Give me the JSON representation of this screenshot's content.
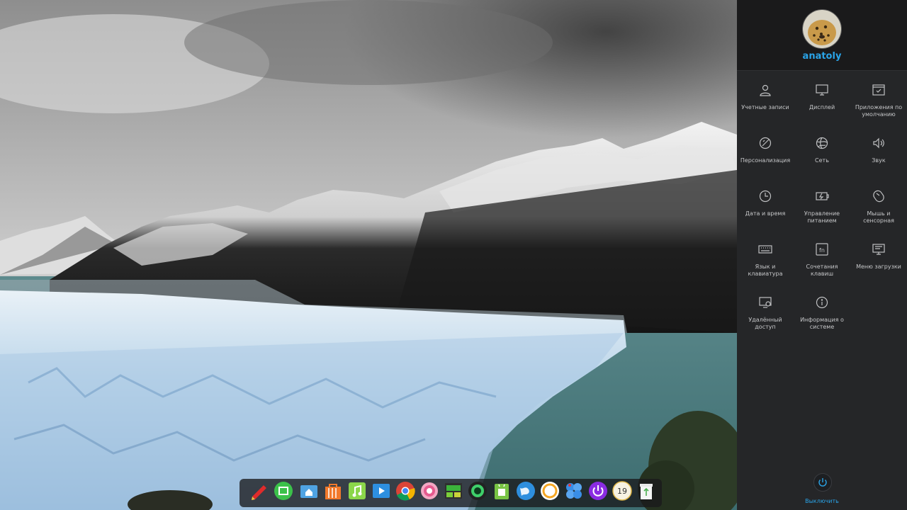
{
  "user": {
    "name": "anatoly"
  },
  "settings": {
    "items": [
      {
        "label": "Учетные записи",
        "icon": "user-icon"
      },
      {
        "label": "Дисплей",
        "icon": "monitor-icon"
      },
      {
        "label": "Приложения по умолчанию",
        "icon": "default-apps-icon"
      },
      {
        "label": "Персонализация",
        "icon": "palette-icon"
      },
      {
        "label": "Сеть",
        "icon": "globe-icon"
      },
      {
        "label": "Звук",
        "icon": "speaker-icon"
      },
      {
        "label": "Дата и время",
        "icon": "clock-icon"
      },
      {
        "label": "Управление питанием",
        "icon": "battery-icon"
      },
      {
        "label": "Мышь и сенсорная",
        "icon": "mouse-icon"
      },
      {
        "label": "Язык и клавиатура",
        "icon": "keyboard-icon"
      },
      {
        "label": "Сочетания клавиш",
        "icon": "fn-key-icon"
      },
      {
        "label": "Меню загрузки",
        "icon": "boot-menu-icon"
      },
      {
        "label": "Удалённый доступ",
        "icon": "remote-access-icon"
      },
      {
        "label": "Информация о системе",
        "icon": "info-icon"
      }
    ]
  },
  "power": {
    "label": "Выключить",
    "icon": "power-icon"
  },
  "dock": {
    "items": [
      {
        "name": "launcher-icon"
      },
      {
        "name": "store-icon"
      },
      {
        "name": "file-manager-icon"
      },
      {
        "name": "shop-icon"
      },
      {
        "name": "music-icon"
      },
      {
        "name": "video-icon"
      },
      {
        "name": "chrome-icon"
      },
      {
        "name": "settings-flower-icon"
      },
      {
        "name": "terminal-icon"
      },
      {
        "name": "camera-icon"
      },
      {
        "name": "android-icon"
      },
      {
        "name": "browser-globe-icon"
      },
      {
        "name": "ring-app-icon"
      },
      {
        "name": "switcher-icon"
      },
      {
        "name": "dock-power-icon"
      },
      {
        "name": "calendar-icon"
      },
      {
        "name": "trash-icon"
      }
    ],
    "calendar_text": "19"
  },
  "colors": {
    "accent": "#2aa4e8",
    "panel_bg": "#252628",
    "header_bg": "#1a1a1b"
  }
}
